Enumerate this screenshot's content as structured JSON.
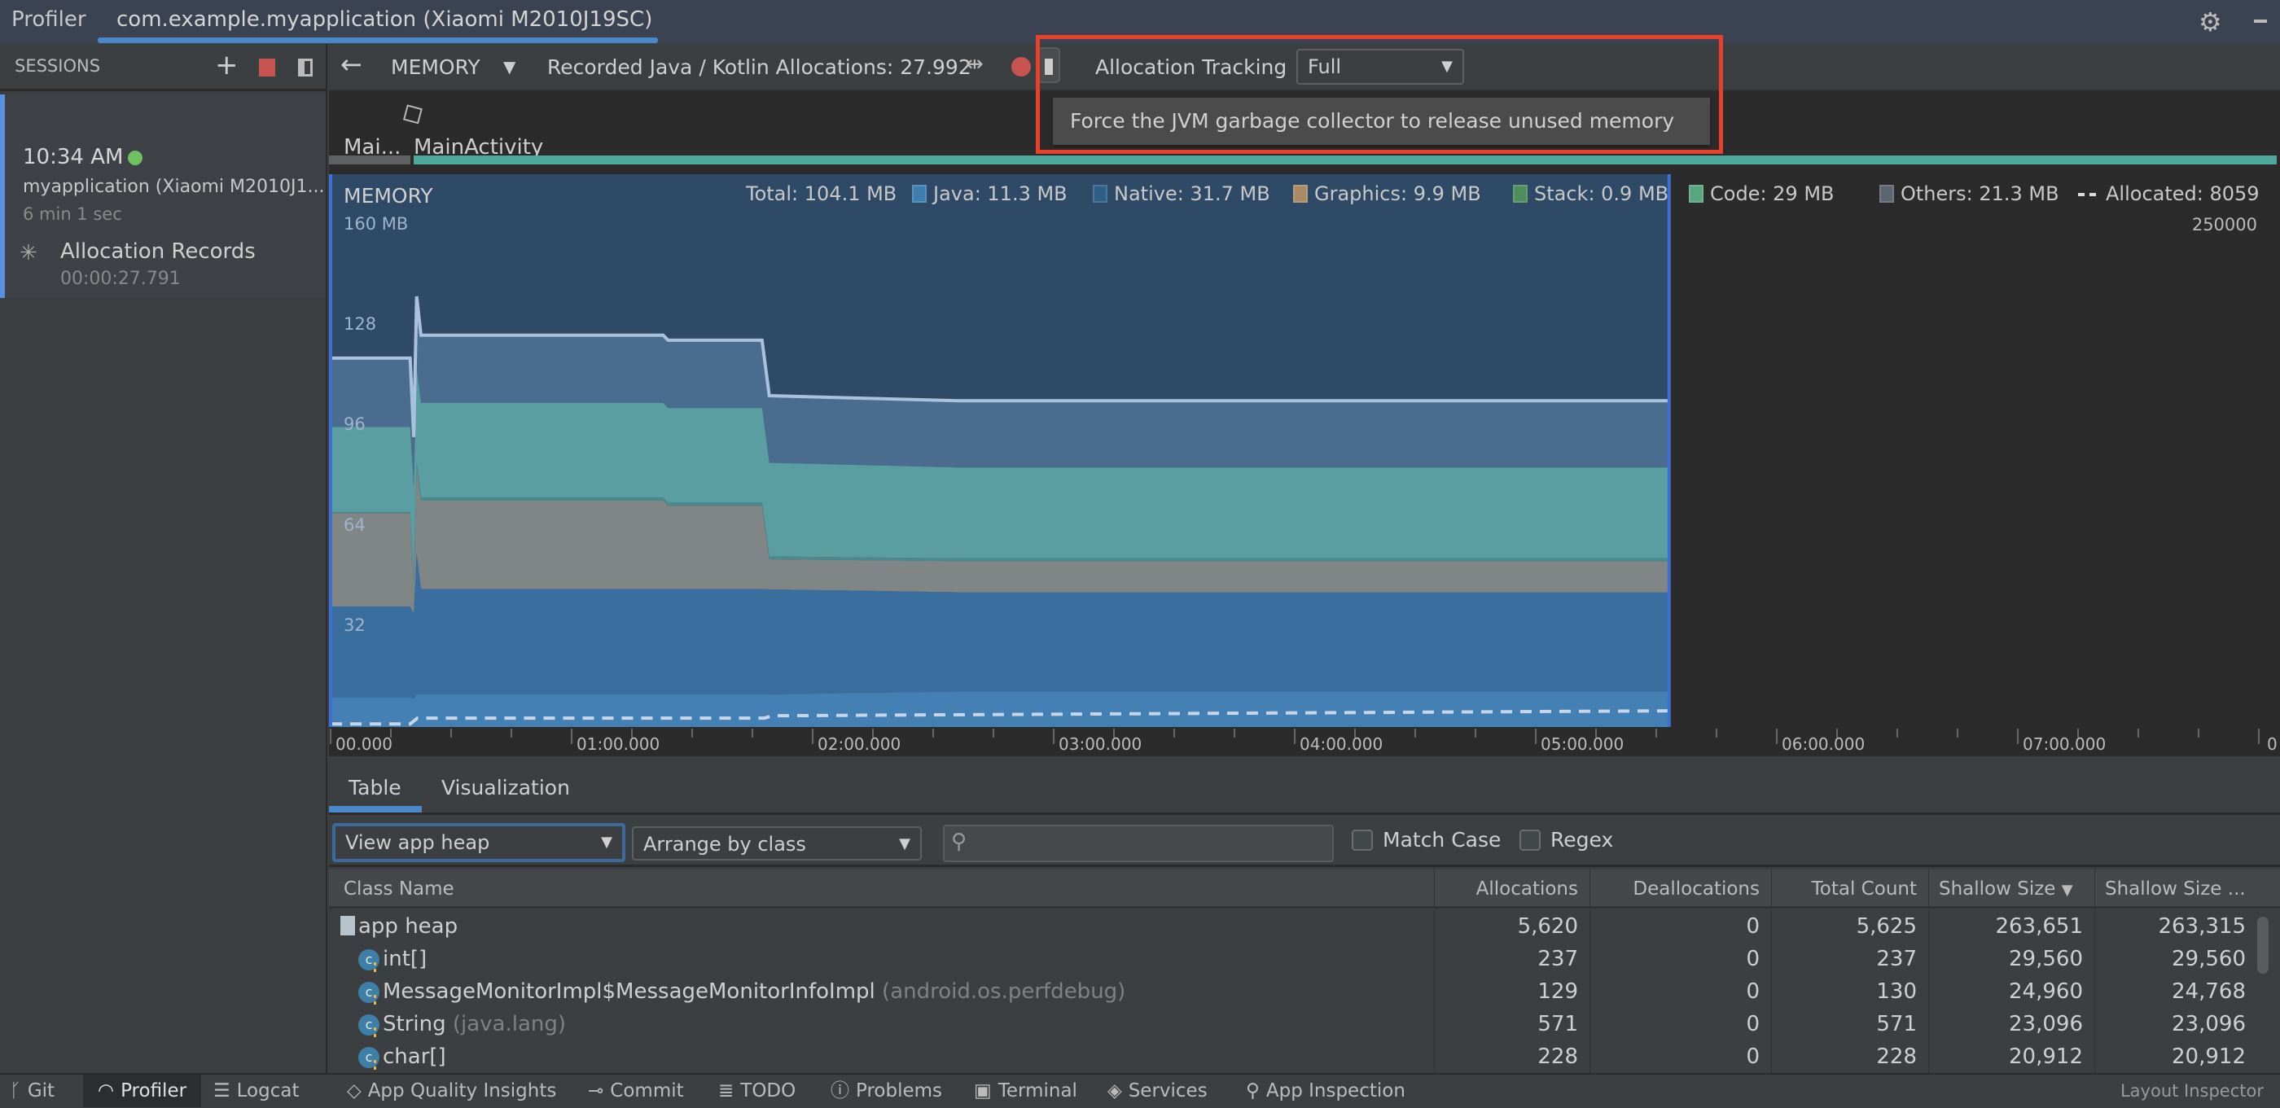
{
  "titlebar": {
    "app": "Profiler",
    "tab": "com.example.myapplication (Xiaomi M2010J19SC)",
    "settings_icon": "gear-icon"
  },
  "sessions": {
    "header": "SESSIONS",
    "time": "10:34 AM",
    "status_color": "#6ec060",
    "app": "myapplication (Xiaomi M2010J1...",
    "duration": "6 min 1 sec",
    "record_label": "Allocation Records",
    "record_time": "00:00:27.791"
  },
  "toolbar": {
    "monitor": "MEMORY",
    "recorded": "Recorded Java / Kotlin Allocations: 27.992",
    "tracking_label": "Allocation Tracking",
    "tracking_value": "Full",
    "tooltip": "Force the JVM garbage collector to release unused memory",
    "record_color": "#c75450",
    "highlight_color": "#e8402a"
  },
  "events": {
    "activity_short": "Mai...",
    "activity": "MainActivity"
  },
  "chart_data": {
    "type": "area",
    "title": "MEMORY",
    "stacked": true,
    "x_unit": "minutes",
    "xlim": [
      0,
      8
    ],
    "ylim": [
      0,
      160
    ],
    "y_ticks": [
      "160 MB",
      "128",
      "96",
      "64",
      "32"
    ],
    "y_tick_values": [
      160,
      128,
      96,
      64,
      32
    ],
    "y2_tick": "250000",
    "y2lim": [
      0,
      250000
    ],
    "x_ticks": [
      "00.000",
      "01:00.000",
      "02:00.000",
      "03:00.000",
      "04:00.000",
      "05:00.000",
      "06:00.000",
      "07:00.000",
      "0"
    ],
    "legend": {
      "total": "Total: 104.1 MB",
      "allocated": "Allocated: 8059",
      "placement": "top"
    },
    "series": [
      {
        "name": "Java",
        "label": "Java: 11.3 MB",
        "color": "#4480b4",
        "legend_color": "#3e7fb0"
      },
      {
        "name": "Native",
        "label": "Native: 31.7 MB",
        "color": "#3a6e9e",
        "legend_color": "#2f5e88"
      },
      {
        "name": "Graphics",
        "label": "Graphics: 9.9 MB",
        "color": "#808586",
        "legend_color": "#a88b66"
      },
      {
        "name": "Stack",
        "label": "Stack: 0.9 MB",
        "color": "#4a8a8c",
        "legend_color": "#4d8d5e"
      },
      {
        "name": "Code",
        "label": "Code: 29 MB",
        "color": "#5a9ea2",
        "legend_color": "#5aa57e"
      },
      {
        "name": "Others",
        "label": "Others: 21.3 MB",
        "color": "#4a6d8f",
        "legend_color": "#5c6670"
      }
    ],
    "x": [
      0,
      0.33,
      0.345,
      0.357,
      0.375,
      1.38,
      1.4,
      1.79,
      1.82,
      2.6,
      5.55
    ],
    "values": [
      [
        9.4,
        29,
        29.8,
        0.5,
        27,
        22
      ],
      [
        9.4,
        29,
        29.8,
        0.5,
        27,
        22
      ],
      [
        9,
        27,
        10,
        0.5,
        30,
        16
      ],
      [
        10.4,
        45,
        28,
        1,
        30,
        23
      ],
      [
        10.4,
        33.6,
        28.2,
        1,
        30.2,
        21.6
      ],
      [
        10.4,
        33.6,
        28.2,
        1,
        30.2,
        21.6
      ],
      [
        10.4,
        33.6,
        26.6,
        1,
        30.2,
        21.6
      ],
      [
        10.4,
        33.6,
        26.6,
        1,
        30.2,
        21.6
      ],
      [
        10.4,
        33.5,
        9.6,
        0.9,
        29.9,
        21.4
      ],
      [
        11.3,
        31.7,
        9.9,
        0.9,
        29,
        21.3
      ],
      [
        11.3,
        31.7,
        9.9,
        0.9,
        29,
        21.3
      ]
    ],
    "allocated": {
      "x": [
        0,
        0.33,
        0.36,
        1.8,
        1.83,
        5.55
      ],
      "values": [
        1500,
        1500,
        4400,
        4400,
        5600,
        8059
      ]
    },
    "selection": [
      0,
      5.55
    ]
  },
  "detail_tabs": [
    "Table",
    "Visualization"
  ],
  "filters": {
    "heap": "View app heap",
    "arrange": "Arrange by class",
    "search_placeholder": "",
    "match_case": "Match Case",
    "regex": "Regex"
  },
  "table": {
    "columns": [
      "Class Name",
      "Allocations",
      "Deallocations",
      "Total Count",
      "Shallow Size",
      "Shallow Size ..."
    ],
    "sort_column": "Shallow Size",
    "rows": [
      {
        "name": "app heap",
        "pkg": "",
        "alloc": "5,620",
        "dealloc": "0",
        "total": "5,625",
        "shallow": "263,651",
        "shallow2": "263,315",
        "type": "folder"
      },
      {
        "name": "int[]",
        "pkg": "",
        "alloc": "237",
        "dealloc": "0",
        "total": "237",
        "shallow": "29,560",
        "shallow2": "29,560",
        "type": "class"
      },
      {
        "name": "MessageMonitorImpl$MessageMonitorInfoImpl",
        "pkg": "(android.os.perfdebug)",
        "alloc": "129",
        "dealloc": "0",
        "total": "130",
        "shallow": "24,960",
        "shallow2": "24,768",
        "type": "class"
      },
      {
        "name": "String",
        "pkg": "(java.lang)",
        "alloc": "571",
        "dealloc": "0",
        "total": "571",
        "shallow": "23,096",
        "shallow2": "23,096",
        "type": "class"
      },
      {
        "name": "char[]",
        "pkg": "",
        "alloc": "228",
        "dealloc": "0",
        "total": "228",
        "shallow": "20,912",
        "shallow2": "20,912",
        "type": "class"
      }
    ]
  },
  "bottombar": {
    "items": [
      {
        "label": "Git",
        "icon": "git-branch-icon"
      },
      {
        "label": "Profiler",
        "icon": "profiler-gauge-icon",
        "active": true
      },
      {
        "label": "Logcat",
        "icon": "logcat-icon"
      },
      {
        "label": "App Quality Insights",
        "icon": "diamond-icon"
      },
      {
        "label": "Commit",
        "icon": "commit-icon"
      },
      {
        "label": "TODO",
        "icon": "list-icon"
      },
      {
        "label": "Problems",
        "icon": "problems-icon"
      },
      {
        "label": "Terminal",
        "icon": "terminal-icon"
      },
      {
        "label": "Services",
        "icon": "services-icon"
      },
      {
        "label": "App Inspection",
        "icon": "inspection-icon"
      }
    ],
    "right": "Layout Inspector"
  }
}
